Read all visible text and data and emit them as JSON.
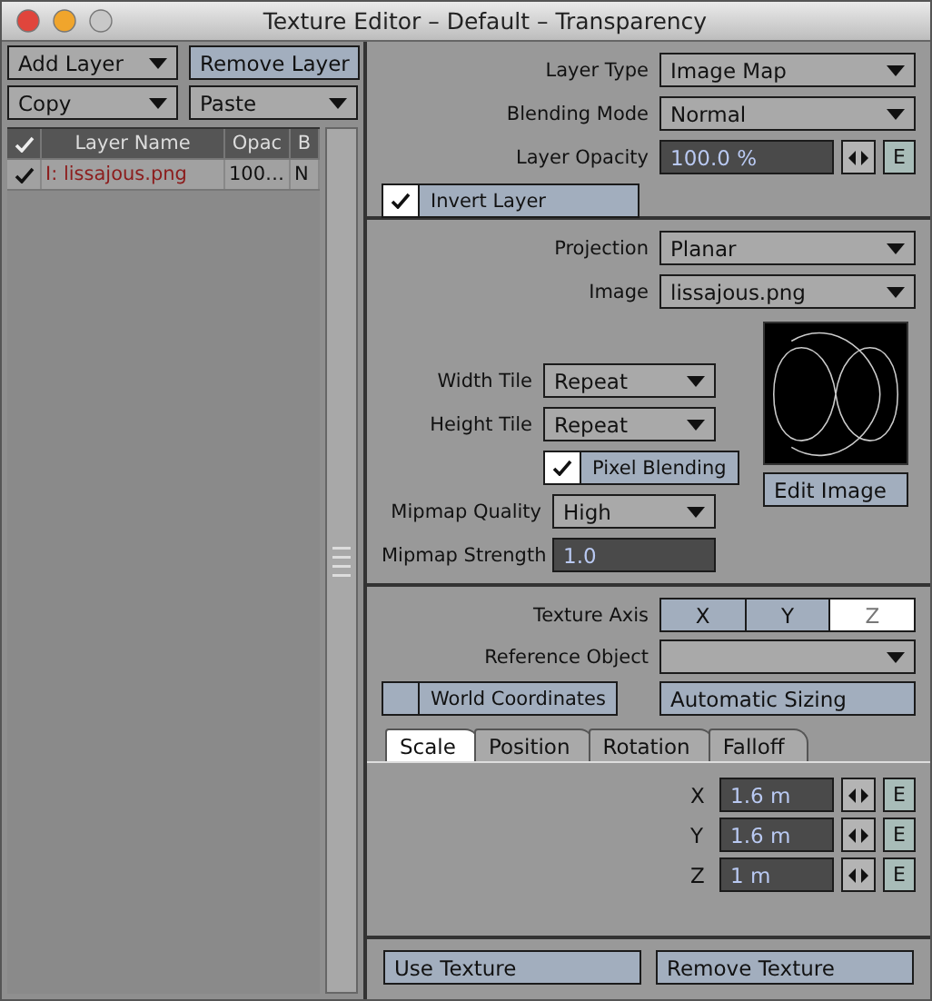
{
  "window": {
    "title": "Texture Editor – Default – Transparency"
  },
  "layers": {
    "add_layer": "Add Layer",
    "remove_layer": "Remove Layer",
    "copy": "Copy",
    "paste": "Paste",
    "columns": [
      "Layer Name",
      "Opac",
      "B"
    ],
    "rows": [
      {
        "checked": true,
        "name": "I: lissajous.png",
        "opacity": "100…",
        "blend": "N"
      }
    ]
  },
  "layer": {
    "fields": [
      {
        "kind": "dropdown",
        "label": "Layer Type",
        "value": "Image Map"
      },
      {
        "kind": "dropdown",
        "label": "Blending Mode",
        "value": "Normal"
      },
      {
        "kind": "number",
        "label": "Layer Opacity",
        "value": "100.0 %",
        "envelope": "E"
      }
    ],
    "invert": {
      "label": "Invert Layer",
      "checked": true
    }
  },
  "image": {
    "fields": [
      {
        "kind": "dropdown",
        "label": "Projection",
        "value": "Planar"
      },
      {
        "kind": "dropdown",
        "label": "Image",
        "value": "lissajous.png"
      }
    ],
    "tiles": [
      {
        "kind": "dropdown",
        "label": "Width Tile",
        "value": "Repeat"
      },
      {
        "kind": "dropdown",
        "label": "Height Tile",
        "value": "Repeat"
      }
    ],
    "pixel_blending": {
      "label": "Pixel Blending",
      "checked": true
    },
    "edit_image": "Edit Image",
    "mipmap": [
      {
        "kind": "dropdown",
        "label": "Mipmap Quality",
        "value": "High"
      },
      {
        "kind": "number",
        "label": "Mipmap Strength",
        "value": "1.0"
      }
    ]
  },
  "axis": {
    "label": "Texture Axis",
    "options": [
      {
        "label": "X",
        "selected": false
      },
      {
        "label": "Y",
        "selected": false
      },
      {
        "label": "Z",
        "selected": true
      }
    ],
    "reference_object": {
      "label": "Reference Object"
    },
    "world_coordinates": {
      "label": "World Coordinates",
      "checked": false
    },
    "automatic_sizing": "Automatic Sizing",
    "tabs": [
      {
        "label": "Scale",
        "selected": true
      },
      {
        "label": "Position",
        "selected": false
      },
      {
        "label": "Rotation",
        "selected": false
      },
      {
        "label": "Falloff",
        "selected": false
      }
    ],
    "values": [
      {
        "label": "X",
        "value": "1.6 m",
        "envelope": "E"
      },
      {
        "label": "Y",
        "value": "1.6 m",
        "envelope": "E"
      },
      {
        "label": "Z",
        "value": "1 m",
        "envelope": "E"
      }
    ]
  },
  "footer": {
    "buttons": [
      "Use Texture",
      "Remove Texture"
    ]
  }
}
